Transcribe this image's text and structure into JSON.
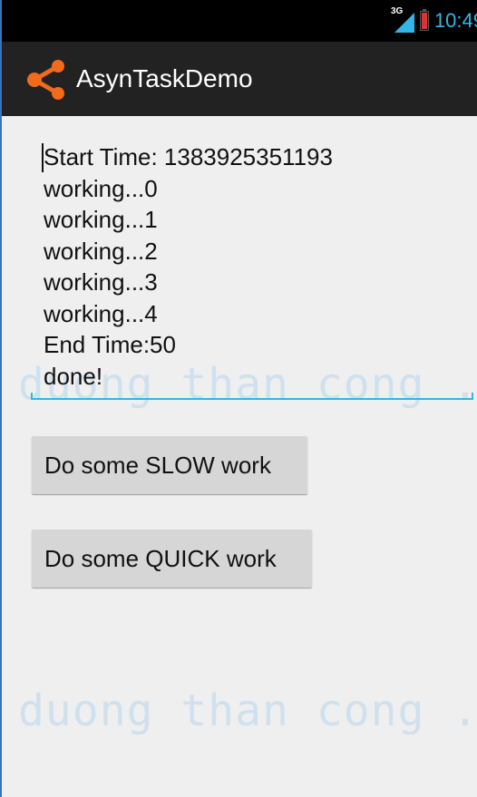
{
  "status_bar": {
    "network": "3G",
    "time": "10:49"
  },
  "action_bar": {
    "title": "AsynTaskDemo",
    "icon": "share-icon"
  },
  "log": {
    "lines": [
      "Start Time: 1383925351193",
      "working...0",
      "working...1",
      "working...2",
      "working...3",
      "working...4",
      "End Time:50",
      "done!"
    ]
  },
  "buttons": {
    "slow_label": "Do some SLOW work",
    "quick_label": "Do some QUICK work"
  },
  "watermark": {
    "text": "duong than cong ."
  },
  "colors": {
    "accent": "#33b5e5",
    "icon_orange": "#f26b1d",
    "action_bar": "#222222"
  }
}
